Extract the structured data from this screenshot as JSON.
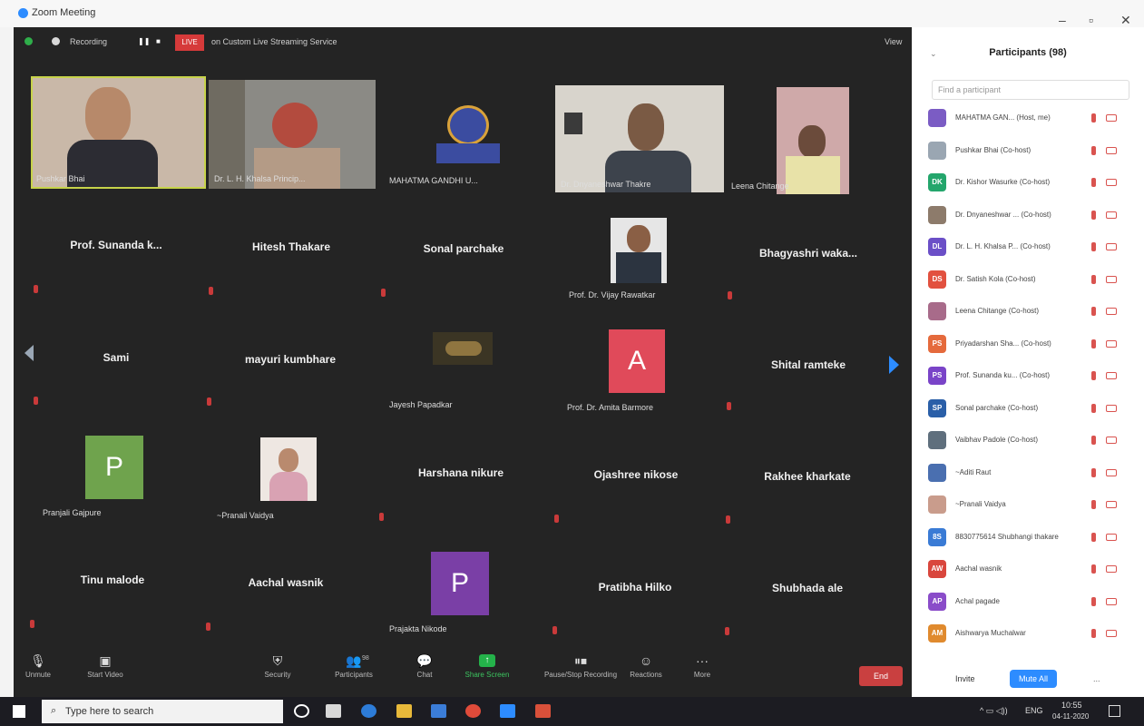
{
  "window": {
    "title": "Zoom Meeting"
  },
  "topbar": {
    "recording": "Recording",
    "live": "LIVE",
    "stream": "on Custom Live Streaming Service",
    "view": "View"
  },
  "video_tiles": [
    {
      "name": "Pushkar Bhai"
    },
    {
      "name": "Dr. L. H. Khalsa Princip..."
    },
    {
      "name": "MAHATMA GANDHI U..."
    },
    {
      "name": "Dr. Dnyaneshwar Thakre"
    },
    {
      "name": "Leena Chitange"
    }
  ],
  "grid_names": {
    "r2": [
      "Prof. Sunanda k...",
      "Hitesh Thakare",
      "Sonal parchake",
      "Bhagyashri waka..."
    ],
    "r3": [
      "Sami",
      "mayuri kumbhare",
      "Shital ramteke"
    ],
    "r4": [
      "Harshana nikure",
      "Ojashree nikose",
      "Rakhee kharkate"
    ],
    "r5": [
      "Tinu malode",
      "Aachal wasnik",
      "Pratibha Hilko",
      "Shubhada ale"
    ]
  },
  "tile_labels": {
    "vijay": "Prof. Dr. Vijay Rawatkar",
    "jayesh": "Jayesh Papadkar",
    "amita": "Prof. Dr. Amita Barmore",
    "pranjali": "Pranjali Gajpure",
    "pranali": "~Pranali Vaidya",
    "prajakta": "Prajakta Nikode"
  },
  "avatars": {
    "amita": "A",
    "pranjali": "P",
    "prajakta": "P"
  },
  "toolbar": {
    "unmute": "Unmute",
    "start_video": "Start Video",
    "security": "Security",
    "participants": "Participants",
    "participants_count": "98",
    "chat": "Chat",
    "share": "Share Screen",
    "pause_rec": "Pause/Stop Recording",
    "reactions": "Reactions",
    "more": "More",
    "end": "End"
  },
  "panel": {
    "title": "Participants (98)",
    "search_placeholder": "Find a participant",
    "participants": [
      {
        "initials": "",
        "name": "MAHATMA GAN... (Host, me)",
        "color": "#7b5cc4"
      },
      {
        "initials": "",
        "name": "Pushkar Bhai (Co-host)",
        "color": "#9aa6b2"
      },
      {
        "initials": "DK",
        "name": "Dr. Kishor Wasurke (Co-host)",
        "color": "#24a66c"
      },
      {
        "initials": "",
        "name": "Dr. Dnyaneshwar ... (Co-host)",
        "color": "#8d7b6b"
      },
      {
        "initials": "DL",
        "name": "Dr. L. H. Khalsa P... (Co-host)",
        "color": "#6b4fc7"
      },
      {
        "initials": "DS",
        "name": "Dr. Satish Kola (Co-host)",
        "color": "#e2513f"
      },
      {
        "initials": "",
        "name": "Leena Chitange (Co-host)",
        "color": "#a86b8a"
      },
      {
        "initials": "PS",
        "name": "Priyadarshan Sha... (Co-host)",
        "color": "#e56a3c"
      },
      {
        "initials": "PS",
        "name": "Prof. Sunanda ku... (Co-host)",
        "color": "#7a44c8"
      },
      {
        "initials": "SP",
        "name": "Sonal parchake (Co-host)",
        "color": "#2a5fa8"
      },
      {
        "initials": "",
        "name": "Vaibhav Padole (Co-host)",
        "color": "#5f6f7d"
      },
      {
        "initials": "",
        "name": "~Aditi Raut",
        "color": "#4a6fb0"
      },
      {
        "initials": "",
        "name": "~Pranali Vaidya",
        "color": "#c99c8c"
      },
      {
        "initials": "8S",
        "name": "8830775614 Shubhangi thakare",
        "color": "#3a7bd5"
      },
      {
        "initials": "AW",
        "name": "Aachal wasnik",
        "color": "#d9463d"
      },
      {
        "initials": "AP",
        "name": "Achal pagade",
        "color": "#8a4cc9"
      },
      {
        "initials": "AM",
        "name": "Aishwarya Muchalwar",
        "color": "#e08a2e"
      }
    ],
    "invite": "Invite",
    "mute_all": "Mute All",
    "more": "..."
  },
  "taskbar": {
    "search": "Type here to search",
    "time": "10:55",
    "date": "04-11-2020",
    "lang": "ENG"
  }
}
